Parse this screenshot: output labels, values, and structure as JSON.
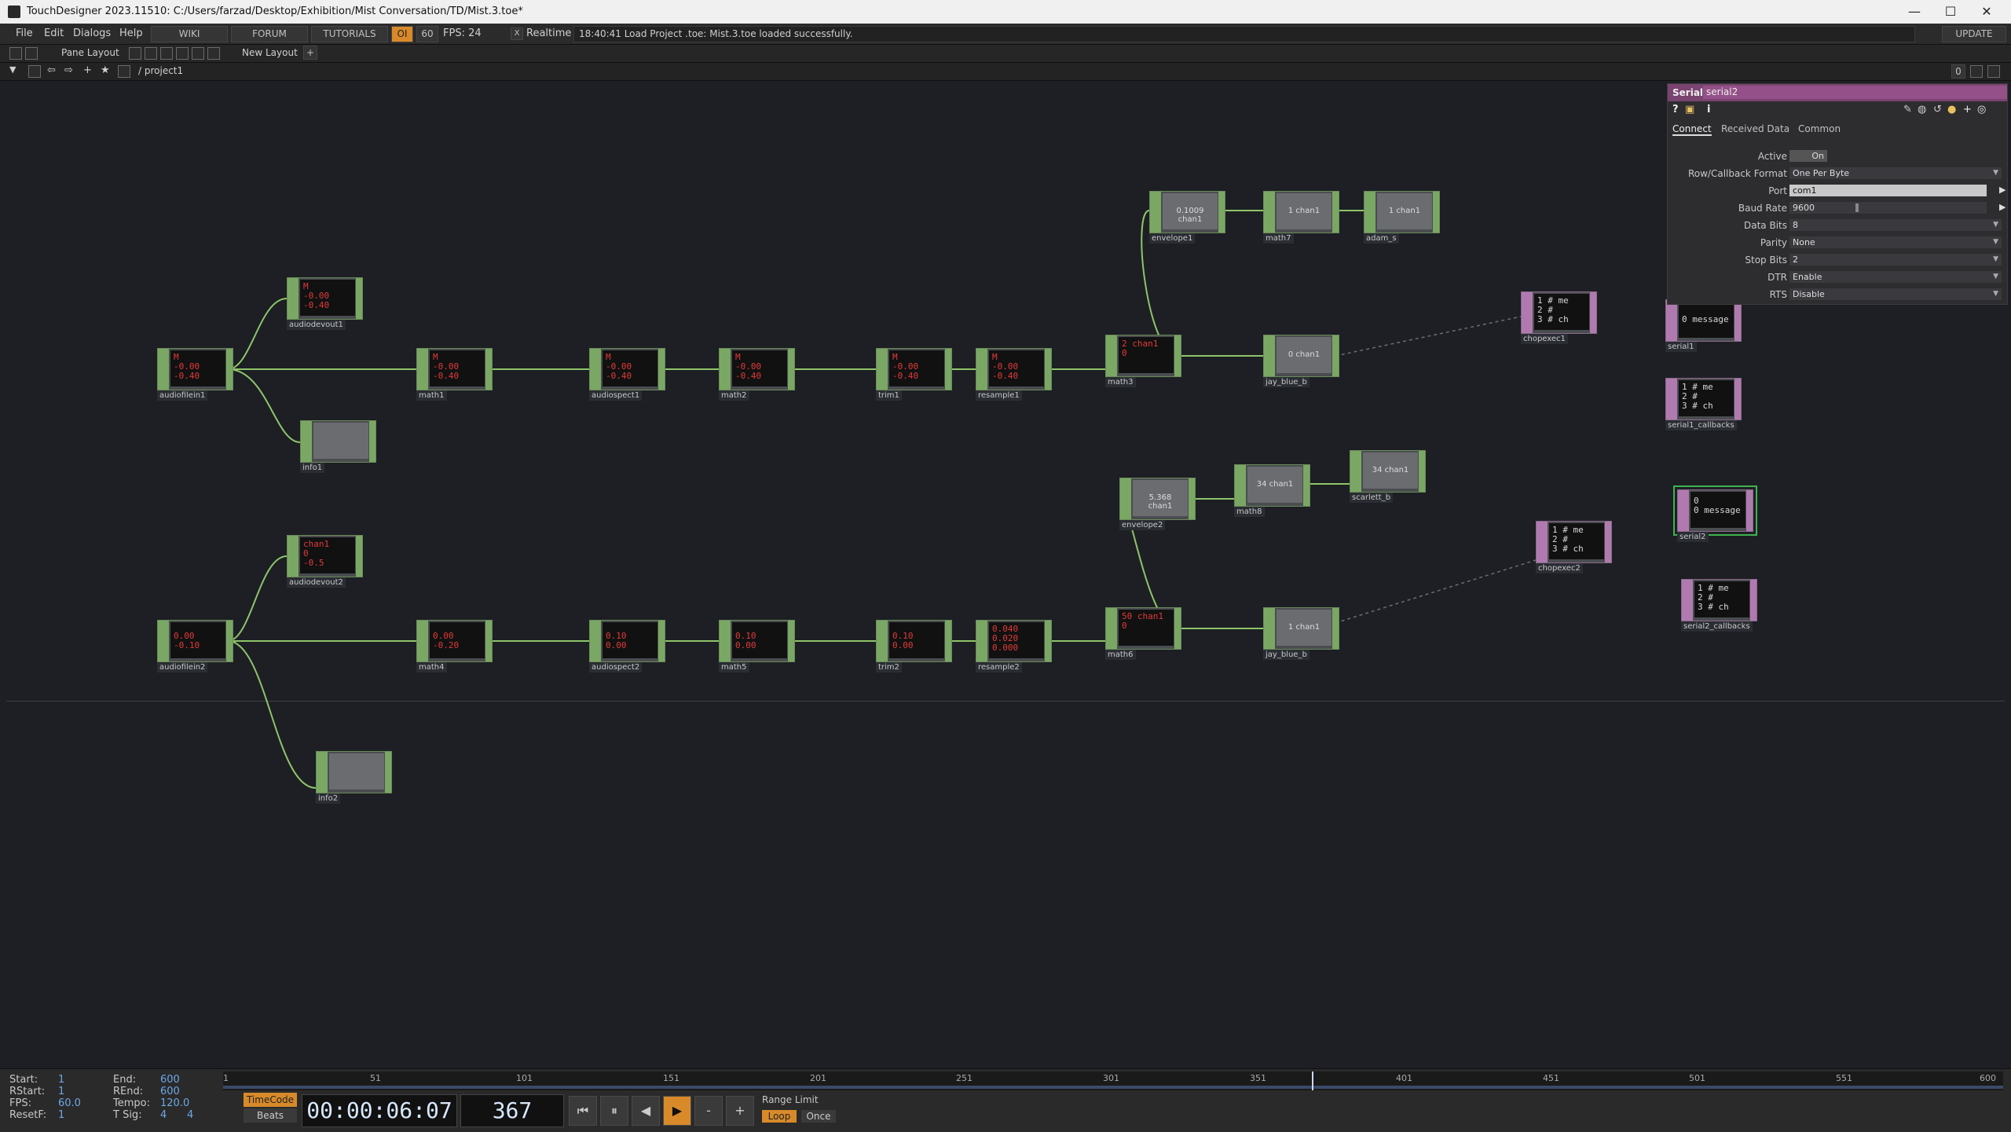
{
  "window": {
    "title": "TouchDesigner 2023.11510: C:/Users/farzad/Desktop/Exhibition/Mist Conversation/TD/Mist.3.toe*",
    "minimize": "—",
    "maximize": "☐",
    "close": "✕"
  },
  "menu": {
    "file": "File",
    "edit": "Edit",
    "dialogs": "Dialogs",
    "help": "Help",
    "wiki": "WIKI",
    "forum": "FORUM",
    "tutorials": "TUTORIALS",
    "oi": "OI",
    "fps_cap": "60",
    "fps": "FPS: 24",
    "realtime_check": "X",
    "realtime": "Realtime",
    "status": "18:40:41 Load Project .toe: Mist.3.toe loaded successfully.",
    "update": "UPDATE"
  },
  "layout": {
    "pane_layout": "Pane Layout",
    "new_layout": "New Layout",
    "plus": "+",
    "pane_index": "0"
  },
  "path": {
    "path": "/ project1"
  },
  "nodes": {
    "audiodevout1": {
      "name": "audiodevout1",
      "text": "M\n-0.00\n-0.40"
    },
    "audiofilein1": {
      "name": "audiofilein1",
      "text": "M\n-0.00\n-0.40"
    },
    "info1": {
      "name": "info1",
      "text": ""
    },
    "math1": {
      "name": "math1",
      "text": "M\n-0.00\n-0.40"
    },
    "audiospect1": {
      "name": "audiospect1",
      "text": "M\n-0.00\n-0.40"
    },
    "math2": {
      "name": "math2",
      "text": "M\n-0.00\n-0.40"
    },
    "trim1": {
      "name": "trim1",
      "text": "M\n-0.00\n-0.40"
    },
    "resample1": {
      "name": "resample1",
      "text": "M\n-0.00\n-0.40"
    },
    "math3": {
      "name": "math3",
      "text": "2 chan1\n0"
    },
    "envelope1": {
      "name": "envelope1",
      "text": "0.1009 chan1"
    },
    "math7": {
      "name": "math7",
      "text": "1 chan1"
    },
    "adam_s": {
      "name": "adam_s",
      "text": "1 chan1"
    },
    "jay_blue_b1": {
      "name": "jay_blue_b",
      "text": "0 chan1"
    },
    "chopexec1": {
      "name": "chopexec1",
      "text": "1 # me\n2 #\n3 # ch"
    },
    "serial1": {
      "name": "serial1",
      "text": "0 message"
    },
    "serial1_callbacks": {
      "name": "serial1_callbacks",
      "text": "1 # me\n2 #\n3 # ch"
    },
    "audiodevout2": {
      "name": "audiodevout2",
      "text": "chan1\n0\n-0.5"
    },
    "audiofilein2": {
      "name": "audiofilein2",
      "text": "0.00\n-0.10"
    },
    "info2": {
      "name": "info2",
      "text": ""
    },
    "math4": {
      "name": "math4",
      "text": "0.00\n-0.20"
    },
    "audiospect2": {
      "name": "audiospect2",
      "text": "0.10\n0.00"
    },
    "math5": {
      "name": "math5",
      "text": "0.10\n0.00"
    },
    "trim2": {
      "name": "trim2",
      "text": "0.10\n0.00"
    },
    "resample2": {
      "name": "resample2",
      "text": "0.040\n0.020\n0.000"
    },
    "math6": {
      "name": "math6",
      "text": "50 chan1\n0"
    },
    "envelope2": {
      "name": "envelope2",
      "text": "5.368 chan1"
    },
    "math8": {
      "name": "math8",
      "text": "34 chan1"
    },
    "scarlett_b": {
      "name": "scarlett_b",
      "text": "34 chan1"
    },
    "jay_blue_b2": {
      "name": "jay_blue_b",
      "text": "1 chan1"
    },
    "chopexec2": {
      "name": "chopexec2",
      "text": "1 # me\n2 #\n3 # ch"
    },
    "serial2": {
      "name": "serial2",
      "text": "0\n0 message"
    },
    "serial2_callbacks": {
      "name": "serial2_callbacks",
      "text": "1 # me\n2 #\n3 # ch"
    }
  },
  "params": {
    "type": "Serial",
    "name": "serial2",
    "tabs": {
      "connect": "Connect",
      "received": "Received Data",
      "common": "Common"
    },
    "active": {
      "label": "Active",
      "value": "On"
    },
    "row_format": {
      "label": "Row/Callback Format",
      "value": "One Per Byte"
    },
    "port": {
      "label": "Port",
      "value": "com1"
    },
    "baud": {
      "label": "Baud Rate",
      "value": "9600"
    },
    "data_bits": {
      "label": "Data Bits",
      "value": "8"
    },
    "parity": {
      "label": "Parity",
      "value": "None"
    },
    "stop_bits": {
      "label": "Stop Bits",
      "value": "2"
    },
    "dtr": {
      "label": "DTR",
      "value": "Enable"
    },
    "rts": {
      "label": "RTS",
      "value": "Disable"
    }
  },
  "timebar": {
    "start_label": "Start:",
    "start": "1",
    "end_label": "End:",
    "end": "600",
    "rstart_label": "RStart:",
    "rstart": "1",
    "rend_label": "REnd:",
    "rend": "600",
    "fps_label": "FPS:",
    "fps": "60.0",
    "tempo_label": "Tempo:",
    "tempo": "120.0",
    "resetf_label": "ResetF:",
    "resetf": "1",
    "tsig_label": "T Sig:",
    "tsig_a": "4",
    "tsig_b": "4",
    "timecode_btn": "TimeCode",
    "beats_btn": "Beats",
    "timecode": "00:00:06:07",
    "frame": "367",
    "range_limit": "Range Limit",
    "loop": "Loop",
    "once": "Once",
    "ticks": [
      "1",
      "51",
      "101",
      "151",
      "201",
      "251",
      "301",
      "351",
      "401",
      "451",
      "501",
      "551",
      "600"
    ]
  }
}
